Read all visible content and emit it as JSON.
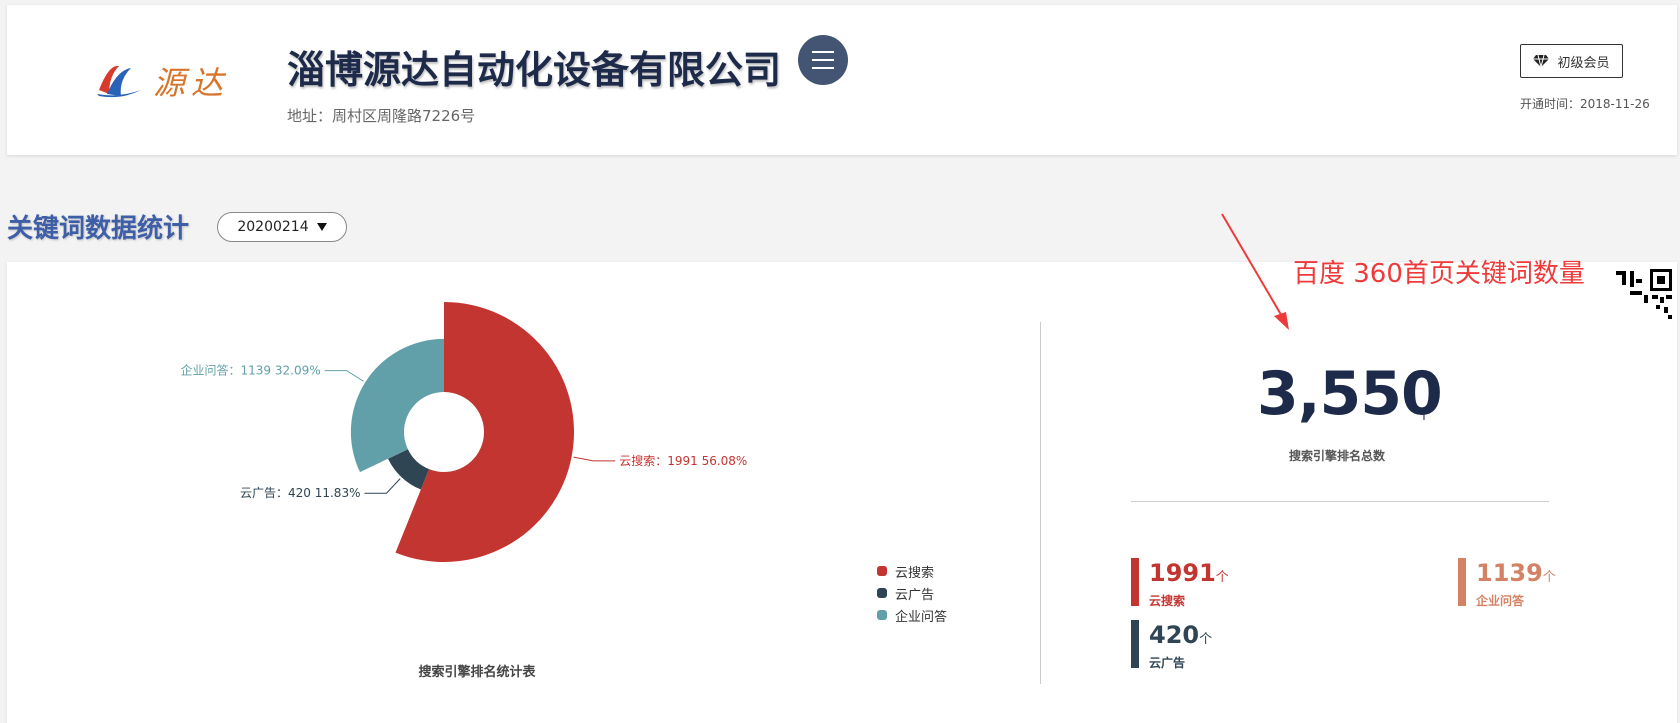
{
  "header": {
    "logo_text": "源达",
    "company_name": "淄博源达自动化设备有限公司",
    "address": "地址：周村区周隆路7226号",
    "member_label": "初级会员",
    "open_time": "开通时间：2018-11-26"
  },
  "section": {
    "title": "关键词数据统计",
    "date_value": "20200214"
  },
  "annotation": {
    "text": "百度 360首页关键词数量"
  },
  "summary": {
    "total": "3,550",
    "unit": "个",
    "total_label": "搜索引擎排名总数",
    "items": [
      {
        "value": "1991",
        "unit": "个",
        "label": "云搜索",
        "color": "#c23531"
      },
      {
        "value": "1139",
        "unit": "个",
        "label": "企业问答",
        "color": "#d48265"
      },
      {
        "value": "420",
        "unit": "个",
        "label": "云广告",
        "color": "#2f4554"
      }
    ]
  },
  "colors": {
    "yunsousuo": "#c23531",
    "yunguanggao": "#2f4554",
    "qiyewenda": "#61a0a8",
    "accent_blue": "#3e5fa8",
    "annotation_red": "#ee3a3a"
  },
  "chart_data": {
    "type": "pie",
    "subtype": "rose",
    "title": "搜索引擎排名统计表",
    "legend_position": "right",
    "series": [
      {
        "name": "云搜索",
        "value": 1991,
        "percent": "56.08%",
        "label": "云搜索：1991    56.08%",
        "color": "#c23531"
      },
      {
        "name": "云广告",
        "value": 420,
        "percent": "11.83%",
        "label": "云广告：420    11.83%",
        "color": "#2f4554"
      },
      {
        "name": "企业问答",
        "value": 1139,
        "percent": "32.09%",
        "label": "企业问答：1139    32.09%",
        "color": "#61a0a8"
      }
    ]
  },
  "icons": {
    "menu": "hamburger-icon",
    "member": "diamond-icon",
    "select": "caret-down-icon",
    "qr": "qr-code-icon"
  }
}
